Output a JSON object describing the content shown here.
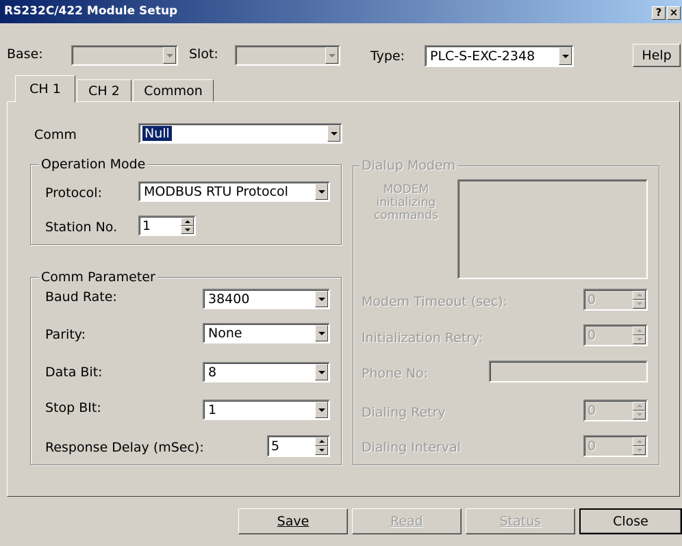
{
  "window": {
    "title": "RS232C/422 Module Setup",
    "help_glyph": "?",
    "close_glyph": "×"
  },
  "header": {
    "base_label": "Base:",
    "base_value": "",
    "slot_label": "Slot:",
    "slot_value": "",
    "type_label": "Type:",
    "type_value": "PLC-S-EXC-2348",
    "help_label": "Help"
  },
  "tabs": [
    "CH 1",
    "CH 2",
    "Common"
  ],
  "comm": {
    "label": "Comm",
    "value": "Null"
  },
  "operation_mode": {
    "title": "Operation Mode",
    "protocol_label": "Protocol:",
    "protocol_value": "MODBUS RTU Protocol",
    "station_label": "Station No.",
    "station_value": "1"
  },
  "comm_parameter": {
    "title": "Comm Parameter",
    "baud_label": "Baud Rate:",
    "baud_value": "38400",
    "parity_label": "Parity:",
    "parity_value": "None",
    "databit_label": "Data Bit:",
    "databit_value": "8",
    "stopbit_label": "Stop BIt:",
    "stopbit_value": "1",
    "delay_label": "Response Delay (mSec):",
    "delay_value": "5"
  },
  "dialup_modem": {
    "title": "Dialup Modem",
    "init_label_1": "MODEM",
    "init_label_2": "initializing",
    "init_label_3": "commands",
    "init_value": "",
    "timeout_label": "Modem Timeout (sec):",
    "timeout_value": "0",
    "init_retry_label": "Initialization Retry:",
    "init_retry_value": "0",
    "phone_label": "Phone No:",
    "phone_value": "",
    "dial_retry_label": "Dialing Retry",
    "dial_retry_value": "0",
    "dial_interval_label": "Dialing Interval",
    "dial_interval_value": "0"
  },
  "buttons": {
    "save": "Save",
    "read": "Read",
    "status": "Status",
    "close": "Close"
  }
}
